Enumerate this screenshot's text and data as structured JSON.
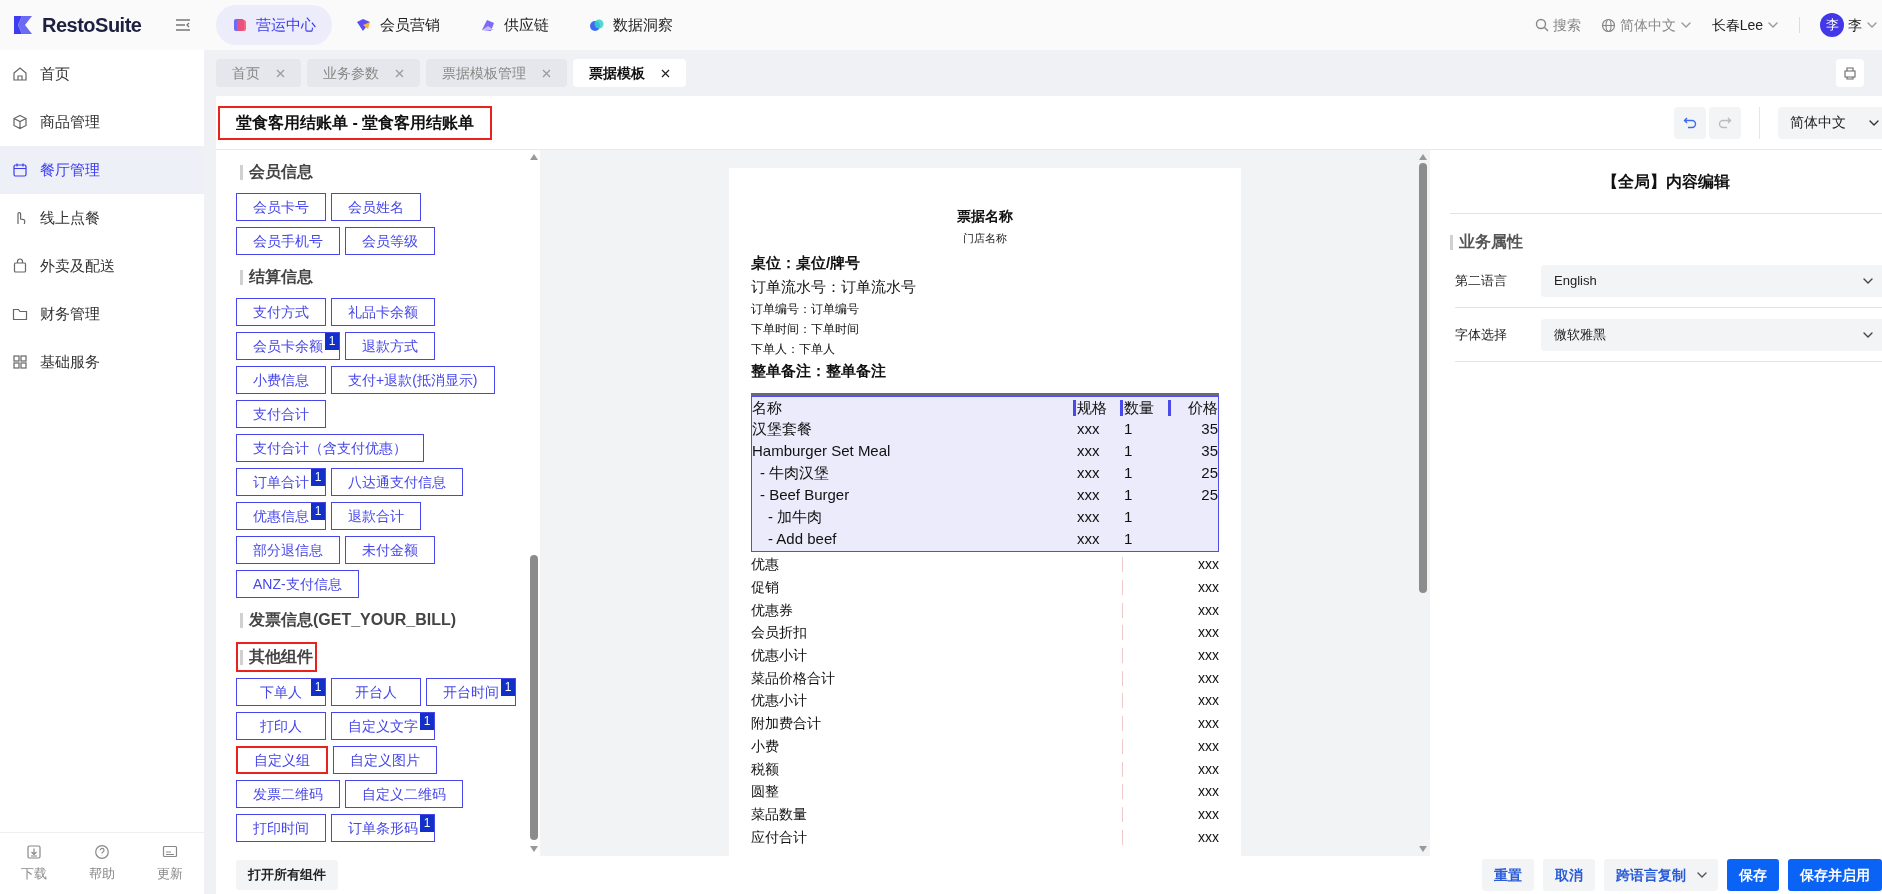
{
  "brand": "RestoSuite",
  "top_nav": [
    {
      "label": "营运中心",
      "selected": true
    },
    {
      "label": "会员营销",
      "selected": false
    },
    {
      "label": "供应链",
      "selected": false
    },
    {
      "label": "数据洞察",
      "selected": false
    }
  ],
  "top_right": {
    "search": "搜索",
    "language": "简体中文",
    "store": "长春Lee",
    "avatar": "李",
    "user": "李"
  },
  "sidebar": {
    "items": [
      {
        "label": "首页",
        "selected": false
      },
      {
        "label": "商品管理",
        "selected": false
      },
      {
        "label": "餐厅管理",
        "selected": true
      },
      {
        "label": "线上点餐",
        "selected": false
      },
      {
        "label": "外卖及配送",
        "selected": false
      },
      {
        "label": "财务管理",
        "selected": false
      },
      {
        "label": "基础服务",
        "selected": false
      }
    ],
    "footer": [
      "下载",
      "帮助",
      "更新"
    ]
  },
  "tabs": [
    {
      "label": "首页",
      "selected": false
    },
    {
      "label": "业务参数",
      "selected": false
    },
    {
      "label": "票据模板管理",
      "selected": false
    },
    {
      "label": "票据模板",
      "selected": true
    }
  ],
  "editor": {
    "title": "堂食客用结账单 - 堂食客用结账单",
    "title_highlighted": true,
    "language": "简体中文"
  },
  "components": {
    "groups": [
      {
        "title": "会员信息",
        "highlighted": false,
        "rows": [
          [
            {
              "label": "会员卡号",
              "highlighted": false
            },
            {
              "label": "会员姓名",
              "highlighted": false
            }
          ],
          [
            {
              "label": "会员手机号",
              "highlighted": false
            },
            {
              "label": "会员等级",
              "highlighted": false
            }
          ]
        ]
      },
      {
        "title": "结算信息",
        "highlighted": false,
        "rows": [
          [
            {
              "label": "支付方式",
              "highlighted": false
            },
            {
              "label": "礼品卡余额",
              "highlighted": false
            }
          ],
          [
            {
              "label": "会员卡余额",
              "badge": "1",
              "highlighted": false
            },
            {
              "label": "退款方式",
              "highlighted": false
            }
          ],
          [
            {
              "label": "小费信息",
              "highlighted": false
            },
            {
              "label": "支付+退款(抵消显示)",
              "highlighted": false
            }
          ],
          [
            {
              "label": "支付合计",
              "highlighted": false
            }
          ],
          [
            {
              "label": "支付合计（含支付优惠）",
              "highlighted": false
            }
          ],
          [
            {
              "label": "订单合计",
              "badge": "1",
              "highlighted": false
            },
            {
              "label": "八达通支付信息",
              "highlighted": false
            }
          ],
          [
            {
              "label": "优惠信息",
              "badge": "1",
              "highlighted": false
            },
            {
              "label": "退款合计",
              "highlighted": false
            }
          ],
          [
            {
              "label": "部分退信息",
              "highlighted": false
            },
            {
              "label": "未付金额",
              "highlighted": false
            }
          ],
          [
            {
              "label": "ANZ-支付信息",
              "highlighted": false
            }
          ]
        ]
      },
      {
        "title": "发票信息(GET_YOUR_BILL)",
        "highlighted": false
      },
      {
        "title": "其他组件",
        "highlighted": true,
        "rows": [
          [
            {
              "label": "下单人",
              "badge": "1",
              "highlighted": false
            },
            {
              "label": "开台人",
              "highlighted": false
            },
            {
              "label": "开台时间",
              "badge": "1",
              "highlighted": false
            }
          ],
          [
            {
              "label": "打印人",
              "highlighted": false
            },
            {
              "label": "自定义文字",
              "badge": "1",
              "highlighted": false
            }
          ],
          [
            {
              "label": "自定义组",
              "highlighted": true
            },
            {
              "label": "自定义图片",
              "highlighted": false
            }
          ],
          [
            {
              "label": "发票二维码",
              "highlighted": false
            },
            {
              "label": "自定义二维码",
              "highlighted": false
            }
          ],
          [
            {
              "label": "打印时间",
              "highlighted": false
            },
            {
              "label": "订单条形码",
              "badge": "1",
              "highlighted": false
            }
          ]
        ]
      }
    ],
    "open_all": "打开所有组件"
  },
  "receipt": {
    "title": "票据名称",
    "store": "门店名称",
    "header_lines": [
      {
        "kind": "large",
        "text": "桌位：桌位/牌号"
      },
      {
        "kind": "medium",
        "text": "订单流水号：订单流水号"
      },
      {
        "kind": "small",
        "text": "订单编号：订单编号"
      },
      {
        "kind": "small",
        "text": "下单时间：下单时间"
      },
      {
        "kind": "small",
        "text": "下单人：下单人"
      },
      {
        "kind": "large",
        "text": "整单备注：整单备注"
      }
    ],
    "columns": [
      "名称",
      "规格",
      "数量",
      "价格"
    ],
    "items": [
      {
        "lines": [
          {
            "name": "汉堡套餐",
            "spec": "xxx",
            "qty": "1",
            "price": "35"
          },
          {
            "name": "Hamburger Set Meal",
            "spec": "xxx",
            "qty": "1",
            "price": "35"
          }
        ],
        "children": [
          {
            "lines": [
              {
                "name": "- 牛肉汉堡",
                "spec": "xxx",
                "qty": "1",
                "price": "25"
              },
              {
                "name": "- Beef Burger",
                "spec": "xxx",
                "qty": "1",
                "price": "25"
              }
            ],
            "children": [
              {
                "lines": [
                  {
                    "name": "- 加牛肉",
                    "spec": "xxx",
                    "qty": "1"
                  },
                  {
                    "name": "- Add beef",
                    "spec": "xxx",
                    "qty": "1"
                  }
                ]
              }
            ]
          }
        ]
      }
    ],
    "summary": [
      {
        "label": "优惠",
        "value": "xxx"
      },
      {
        "label": "促销",
        "value": "xxx"
      },
      {
        "label": "优惠券",
        "value": "xxx"
      },
      {
        "label": "会员折扣",
        "value": "xxx"
      },
      {
        "label": "优惠小计",
        "value": "xxx"
      },
      {
        "label": "菜品价格合计",
        "value": "xxx"
      },
      {
        "label": "优惠小计",
        "value": "xxx"
      },
      {
        "label": "附加费合计",
        "value": "xxx"
      },
      {
        "label": "小费",
        "value": "xxx"
      },
      {
        "label": "税额",
        "value": "xxx"
      },
      {
        "label": "圆整",
        "value": "xxx"
      },
      {
        "label": "菜品数量",
        "value": "xxx"
      },
      {
        "label": "应付合计",
        "value": "xxx"
      }
    ]
  },
  "properties": {
    "title": "【全局】内容编辑",
    "section": "业务属性",
    "fields": [
      {
        "label": "第二语言",
        "value": "English"
      },
      {
        "label": "字体选择",
        "value": "微软雅黑"
      }
    ]
  },
  "actions": [
    {
      "label": "重置",
      "kind": "secondary"
    },
    {
      "label": "取消",
      "kind": "secondary"
    },
    {
      "label": "跨语言复制",
      "kind": "dropdown"
    },
    {
      "label": "保存",
      "kind": "primary"
    },
    {
      "label": "保存并启用",
      "kind": "primary"
    }
  ]
}
